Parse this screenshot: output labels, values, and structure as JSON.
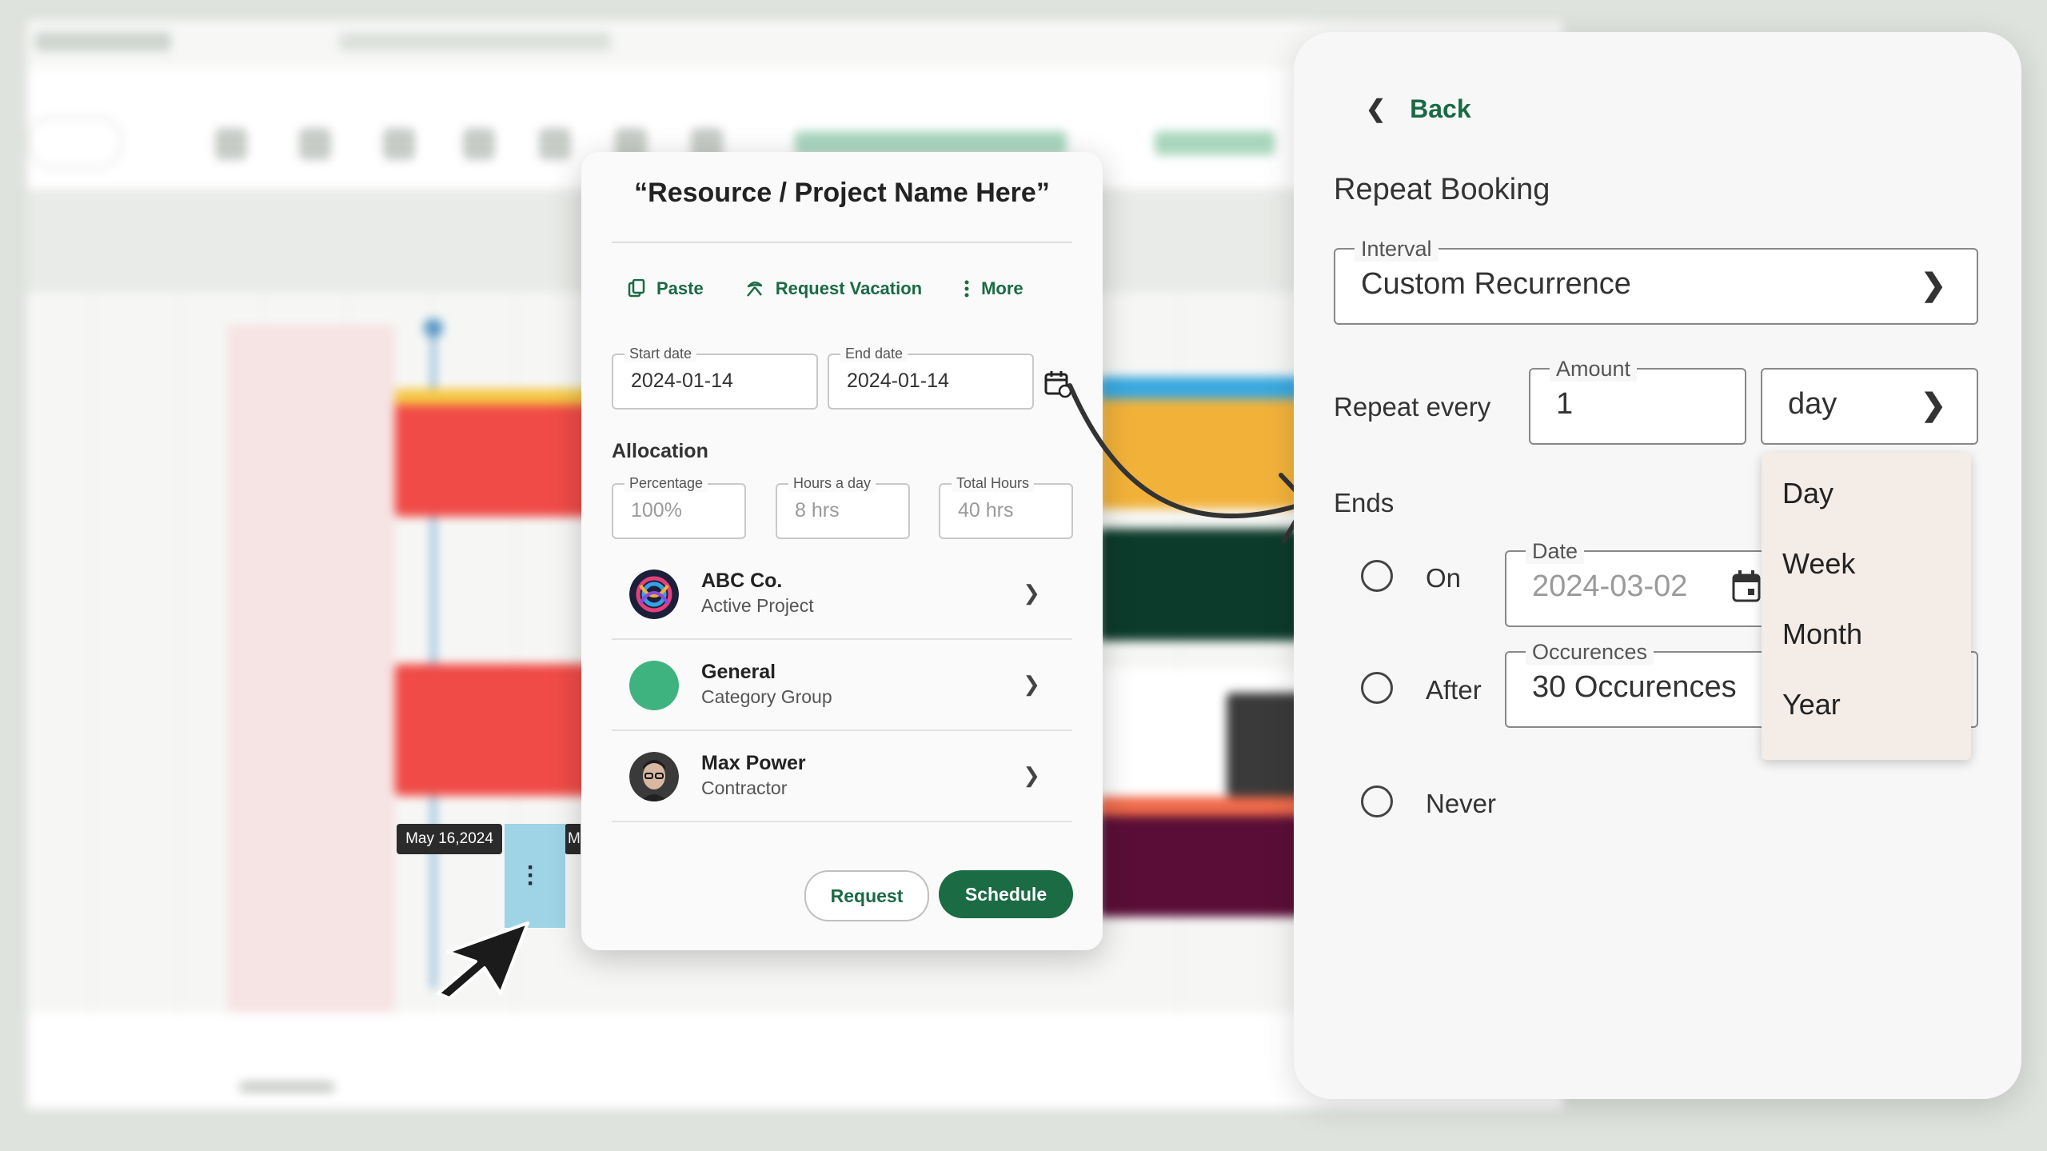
{
  "card": {
    "title": "“Resource / Project Name Here”",
    "actions": {
      "paste": "Paste",
      "request_vacation": "Request Vacation",
      "more": "More"
    },
    "start_date": {
      "label": "Start date",
      "value": "2024-01-14"
    },
    "end_date": {
      "label": "End date",
      "value": "2024-01-14"
    },
    "allocation": {
      "title": "Allocation",
      "percentage": {
        "label": "Percentage",
        "placeholder": "100%"
      },
      "hours_day": {
        "label": "Hours a day",
        "placeholder": "8 hrs"
      },
      "total_hours": {
        "label": "Total Hours",
        "placeholder": "40 hrs"
      }
    },
    "rows": [
      {
        "name": "ABC Co.",
        "sub": "Active Project"
      },
      {
        "name": "General",
        "sub": "Category Group"
      },
      {
        "name": "Max Power",
        "sub": "Contractor"
      }
    ],
    "request_btn": "Request",
    "schedule_btn": "Schedule"
  },
  "timeline": {
    "date_tooltip": "May 16,2024",
    "date_tooltip_partial": "M"
  },
  "panel": {
    "back": "Back",
    "title": "Repeat Booking",
    "interval": {
      "label": "Interval",
      "value": "Custom Recurrence"
    },
    "repeat_every": "Repeat every",
    "amount": {
      "label": "Amount",
      "value": "1"
    },
    "unit": {
      "value": "day"
    },
    "ends": "Ends",
    "on": "On",
    "date": {
      "label": "Date",
      "placeholder": "2024-03-02"
    },
    "after": "After",
    "occurences": {
      "label": "Occurences",
      "value": "30 Occurences"
    },
    "never": "Never",
    "menu": [
      "Day",
      "Week",
      "Month",
      "Year"
    ]
  },
  "colors": {
    "accent": "#1b6b45",
    "selection": "#9fd3e6",
    "menu_bg": "#f4ece6"
  },
  "icons": [
    "paste-icon",
    "vacation-icon",
    "more-vertical-icon",
    "calendar-refresh-icon",
    "chevron-right-icon",
    "chevron-left-icon",
    "calendar-icon",
    "cursor-pointer-icon"
  ]
}
